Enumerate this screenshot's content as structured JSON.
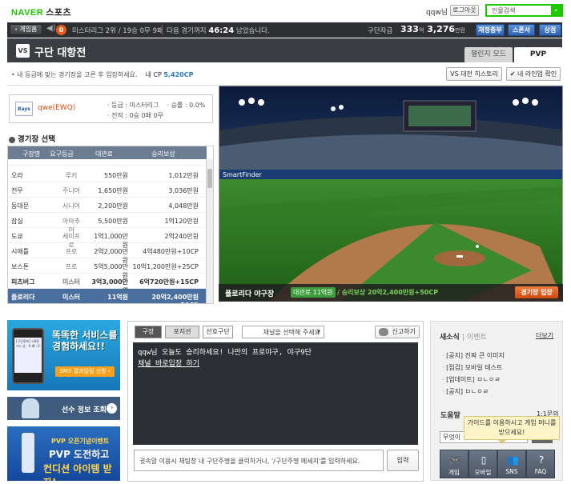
{
  "header": {
    "logo": "NAVER",
    "section": "스포츠",
    "user": "qqw님",
    "logout": "로그아웃",
    "search_placeholder": "인물검색"
  },
  "statusbar": {
    "home": "게임홈",
    "badge": "0",
    "league_info": "미스터리그 2위 / 19승 0무 9패",
    "next_game_prefix": "다음 경기까지",
    "next_game_time": "46:24",
    "next_game_suffix": "남았습니다.",
    "fund_label": "구단자금",
    "fund_eok": "333",
    "fund_man": "3,276",
    "unit_eok": "억",
    "unit_man": "만원",
    "btn_charge": "재정충부",
    "btn_sponsor": "스폰서",
    "btn_shop": "상점"
  },
  "page": {
    "vs_icon": "VS",
    "title": "구단 대항전",
    "tab_challenge": "챌린지 모드",
    "tab_pvp": "PVP",
    "info_text": "• 내 등급에 맞는 경기장을 고른 후 입장하세요.",
    "my_cp_label": "내 CP",
    "my_cp": "5,420CP",
    "btn_history": "VS 대전 히스토리",
    "btn_lineup": "✔ 내 라인업 확인"
  },
  "team": {
    "logo_text": "Rays",
    "name": "qwe(EWQ)",
    "grade": "· 등급 : 미스터리그",
    "winrate": "· 승률 : 0.0%",
    "record": "· 전적 : 0승 0패 0무"
  },
  "stadium_select": {
    "title": "경기장 선택",
    "headers": [
      "구장명",
      "요구등급",
      "대관료",
      "승리보상"
    ],
    "rows": [
      {
        "name": "오라",
        "grade": "루키",
        "fee": "550만원",
        "reward": "1,012만원"
      },
      {
        "name": "전무",
        "grade": "주니어",
        "fee": "1,650만원",
        "reward": "3,036만원"
      },
      {
        "name": "동대문",
        "grade": "시니어",
        "fee": "2,200만원",
        "reward": "4,048만원"
      },
      {
        "name": "잠실",
        "grade": "아마추어",
        "fee": "5,500만원",
        "reward": "1억120만원"
      },
      {
        "name": "도쿄",
        "grade": "세미프로",
        "fee": "1억1,000만원",
        "reward": "2억240만원"
      },
      {
        "name": "시애틀",
        "grade": "프로",
        "fee": "2억2,000만원",
        "reward": "4억480만원+10CP"
      },
      {
        "name": "보스톤",
        "grade": "프로",
        "fee": "5억5,000만원",
        "reward": "10억1,200만원+25CP"
      },
      {
        "name": "피츠버그",
        "grade": "미스터",
        "fee": "3억3,000만원",
        "reward": "6억720만원+15CP"
      },
      {
        "name": "플로리다",
        "grade": "미스터",
        "fee": "11억원",
        "reward": "20억2,400만원+50CP"
      }
    ]
  },
  "stadium": {
    "name": "플로리다 야구장",
    "fee_label": "대관료 11억원",
    "reward_label": "/ 승리보상 20억2,400만원+50CP",
    "enter": "경기장 입장",
    "sign_left": "SmartFinder"
  },
  "ads": {
    "ad1_title": "똑똑한 서비스를 경험하세요!!",
    "ad1_btn": "SMS 결과알림 신청 ›",
    "ad1_screen": "[구단정보] <8경기> 승 : 0 패 : 0",
    "ad2_text": "선수 정보 조회",
    "ad3_t1": "PVP 오픈기념이벤트",
    "ad3_t2": "PVP 도전하고",
    "ad3_t3": "컨디션 아이템 받자!"
  },
  "chat": {
    "tab1": "구장",
    "tab2": "포지션",
    "tab3": "선호구단",
    "channel_placeholder": "채널을 선택해 주세요",
    "report": "신고하기",
    "message": "qqw님 오늘도 승리하세요! 나만의 프로야구, 야구9단",
    "link": "채널 바로입장 하기",
    "input_placeholder": "귓속말 이용시 채팅창 내 구단주명을 클릭하거나, '/구단주명 메세지'를 입력하세요.",
    "send": "입력"
  },
  "news": {
    "title": "새소식",
    "sub": "| 이벤트",
    "more": "더보기",
    "items": [
      "[공지] 진짜 큰 이미지",
      "[점검] 모바일 테스트",
      "[업데이트] ㅁㄴㅇㄹ",
      "[공지] ㅁㄴㅇㄹ"
    ],
    "help_title": "도움말",
    "qna": "1:1문의",
    "help_search": "무엇이",
    "help_btn": "검색",
    "tooltip": "가이드를 이용하시고 게임 머니를 받으세요!",
    "icons": [
      "게임",
      "모바일",
      "SNS",
      "FAQ"
    ]
  }
}
